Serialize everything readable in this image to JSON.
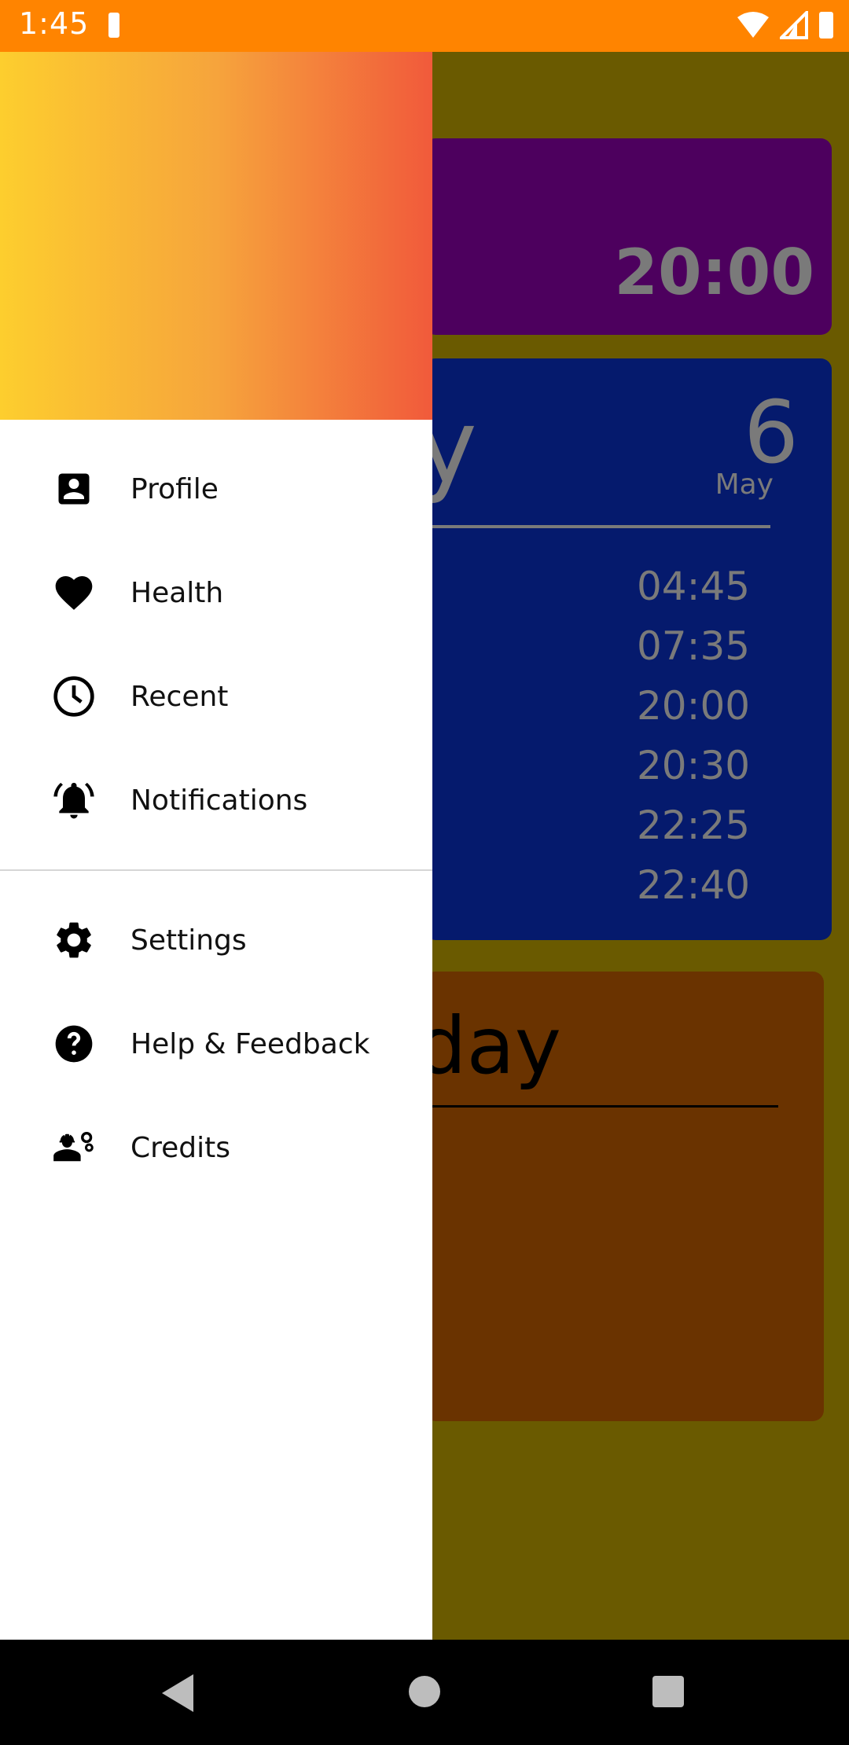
{
  "status_bar": {
    "time": "1:45"
  },
  "background": {
    "card_purple": {
      "time": "20:00"
    },
    "card_blue": {
      "partial_title": "y",
      "day": "6",
      "month": "May",
      "times": [
        "04:45",
        "07:35",
        "20:00",
        "20:30",
        "22:25",
        "22:40"
      ]
    },
    "card_brown": {
      "partial_title": "day"
    }
  },
  "drawer": {
    "menu_items": [
      {
        "label": "Profile",
        "icon": "account-box-icon"
      },
      {
        "label": "Health",
        "icon": "heart-icon"
      },
      {
        "label": "Recent",
        "icon": "clock-icon"
      },
      {
        "label": "Notifications",
        "icon": "bell-icon"
      },
      {
        "label": "Settings",
        "icon": "gear-icon"
      },
      {
        "label": "Help & Feedback",
        "icon": "help-icon"
      },
      {
        "label": "Credits",
        "icon": "engineer-icon"
      }
    ]
  },
  "colors": {
    "status_bar": "#ff8400",
    "header_gradient_start": "#fdce2e",
    "header_gradient_end": "#f15a3b",
    "card_purple": "#4d005e",
    "card_blue": "#051a6d",
    "card_brown": "#6a3300"
  }
}
